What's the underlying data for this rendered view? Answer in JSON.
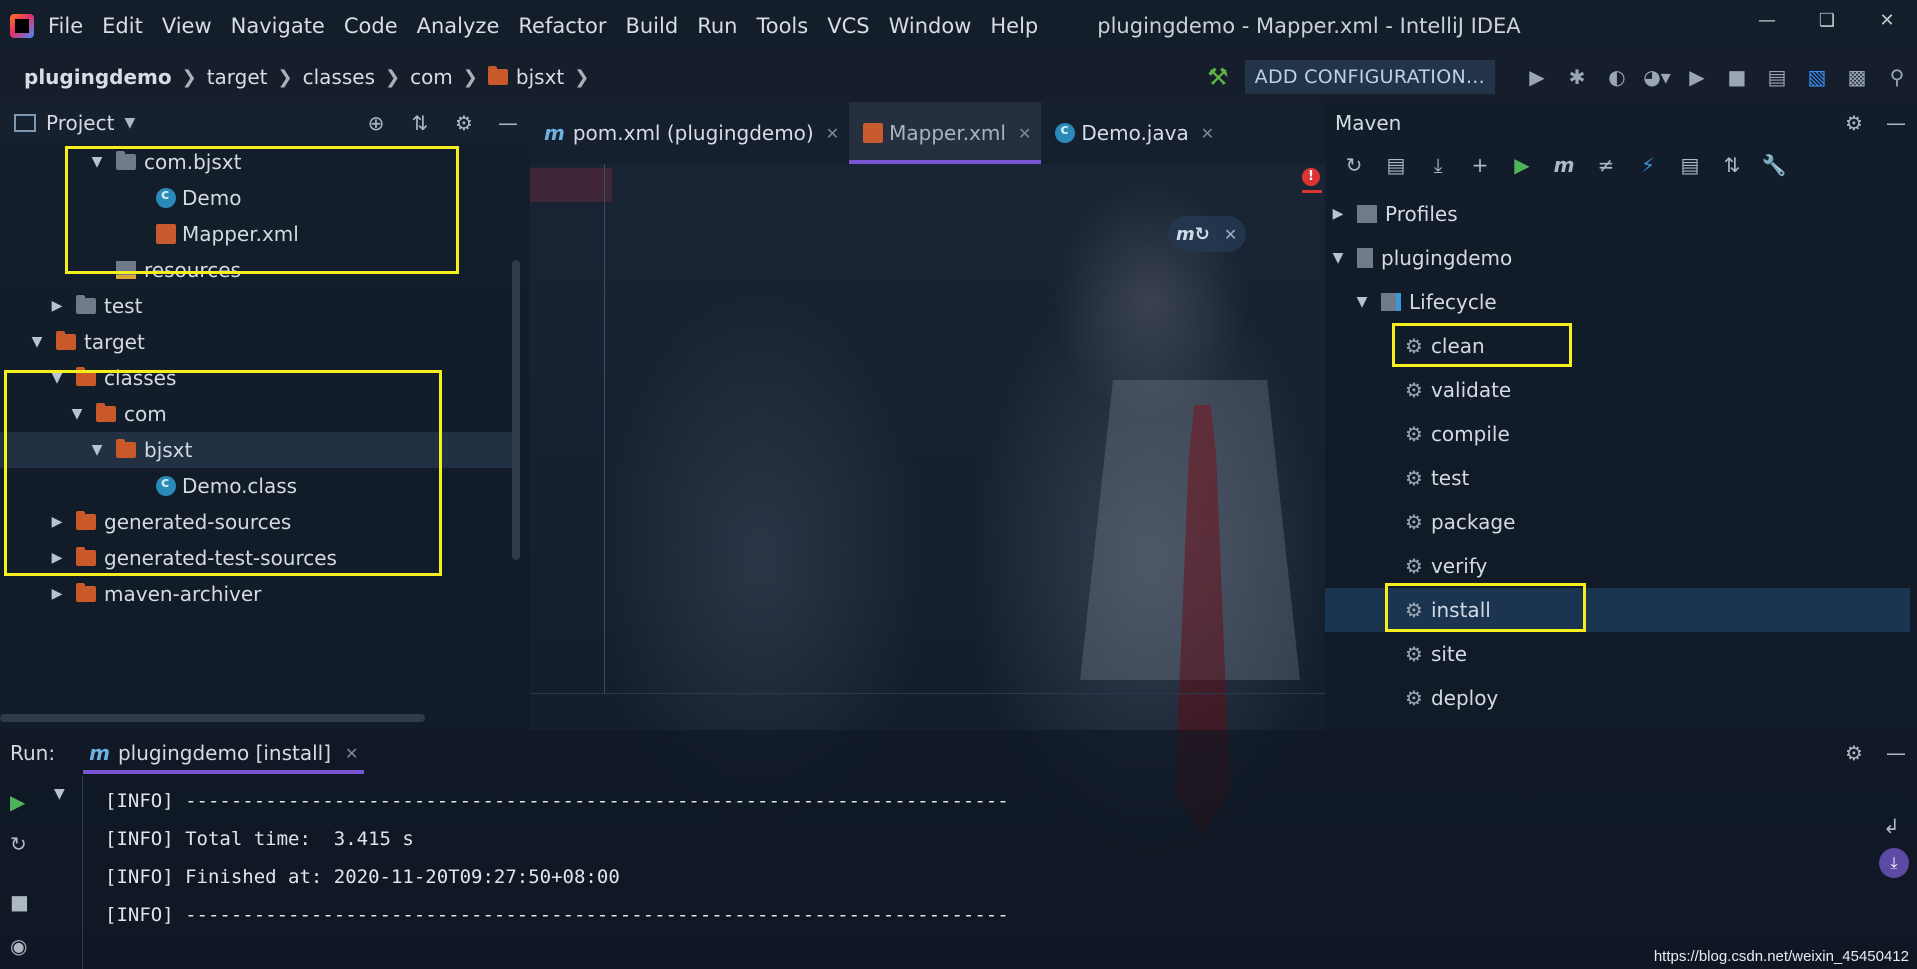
{
  "app": {
    "menu": [
      "File",
      "Edit",
      "View",
      "Navigate",
      "Code",
      "Analyze",
      "Refactor",
      "Build",
      "Run",
      "Tools",
      "VCS",
      "Window",
      "Help"
    ],
    "window_title": "plugingdemo - Mapper.xml - IntelliJ IDEA"
  },
  "breadcrumb": [
    "plugingdemo",
    "target",
    "classes",
    "com",
    "bjsxt"
  ],
  "toolbar": {
    "add_configuration": "ADD CONFIGURATION..."
  },
  "project": {
    "title": "Project",
    "tree": [
      {
        "label": "com.bjsxt",
        "depth": 4,
        "arrow": "▼",
        "icon": "package-folder-icon"
      },
      {
        "label": "Demo",
        "depth": 6,
        "arrow": "",
        "icon": "java-class-icon"
      },
      {
        "label": "Mapper.xml",
        "depth": 6,
        "arrow": "",
        "icon": "xml-file-icon"
      },
      {
        "label": "resources",
        "depth": 4,
        "arrow": "",
        "icon": "resources-folder-icon"
      },
      {
        "label": "test",
        "depth": 2,
        "arrow": "▶",
        "icon": "folder-icon"
      },
      {
        "label": "target",
        "depth": 1,
        "arrow": "▼",
        "icon": "excluded-folder-icon"
      },
      {
        "label": "classes",
        "depth": 2,
        "arrow": "▼",
        "icon": "excluded-folder-icon"
      },
      {
        "label": "com",
        "depth": 3,
        "arrow": "▼",
        "icon": "excluded-folder-icon"
      },
      {
        "label": "bjsxt",
        "depth": 4,
        "arrow": "▼",
        "icon": "excluded-folder-icon"
      },
      {
        "label": "Demo.class",
        "depth": 6,
        "arrow": "",
        "icon": "class-file-icon"
      },
      {
        "label": "generated-sources",
        "depth": 2,
        "arrow": "▶",
        "icon": "excluded-folder-icon"
      },
      {
        "label": "generated-test-sources",
        "depth": 2,
        "arrow": "▶",
        "icon": "excluded-folder-icon"
      },
      {
        "label": "maven-archiver",
        "depth": 2,
        "arrow": "▶",
        "icon": "excluded-folder-icon"
      }
    ]
  },
  "editor": {
    "tabs": [
      {
        "label": "pom.xml (plugingdemo)",
        "icon": "maven-icon",
        "active": false
      },
      {
        "label": "Mapper.xml",
        "icon": "xml-file-icon",
        "active": true
      },
      {
        "label": "Demo.java",
        "icon": "java-class-icon",
        "active": false
      }
    ]
  },
  "maven": {
    "title": "Maven",
    "profiles": "Profiles",
    "project": "plugingdemo",
    "lifecycle": "Lifecycle",
    "goals": [
      "clean",
      "validate",
      "compile",
      "test",
      "package",
      "verify",
      "install",
      "site",
      "deploy"
    ],
    "selected_goal": "install"
  },
  "run": {
    "label": "Run:",
    "tab": "plugingdemo [install]",
    "console": [
      "[INFO] ------------------------------------------------------------------------",
      "[INFO] Total time:  3.415 s",
      "[INFO] Finished at: 2020-11-20T09:27:50+08:00",
      "[INFO] ------------------------------------------------------------------------"
    ]
  },
  "watermark": "https://blog.csdn.net/weixin_45450412"
}
